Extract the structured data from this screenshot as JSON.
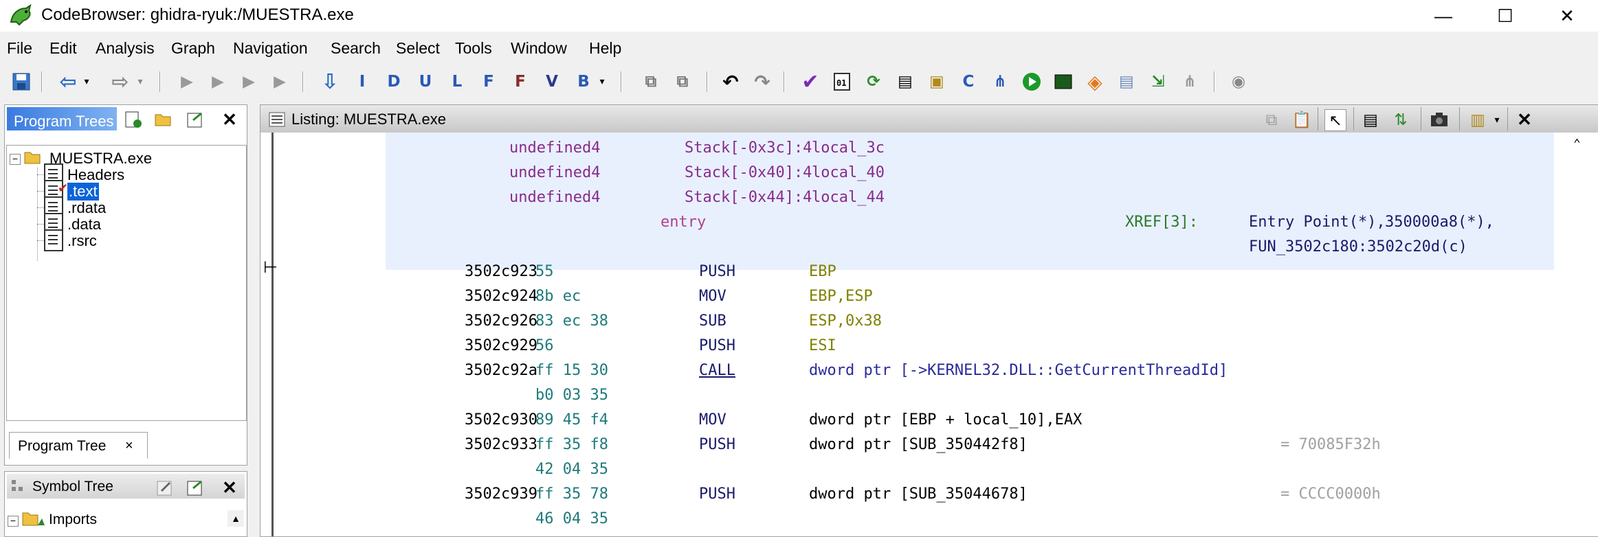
{
  "window": {
    "title": "CodeBrowser: ghidra-ryuk:/MUESTRA.exe",
    "minimize": "—",
    "maximize": "☐",
    "close": "✕"
  },
  "menu": [
    "File",
    "Edit",
    "Analysis",
    "Graph",
    "Navigation",
    "Search",
    "Select",
    "Tools",
    "Window",
    "Help"
  ],
  "toolbar": {
    "letters": [
      "I",
      "D",
      "U",
      "L",
      "F",
      "V",
      "B"
    ]
  },
  "program_trees": {
    "title": "Program Trees",
    "root": "MUESTRA.exe",
    "items": [
      "Headers",
      ".text",
      ".rdata",
      ".data",
      ".rsrc"
    ],
    "selected": ".text",
    "tab_label": "Program Tree",
    "tab_close": "×",
    "close": "✕"
  },
  "symbol_tree": {
    "title": "Symbol Tree",
    "first_item": "Imports",
    "close": "✕"
  },
  "listing": {
    "title": "Listing:  MUESTRA.exe",
    "close": "✕",
    "locals": [
      {
        "type": "undefined4",
        "storage": "Stack[-0x3c]:4",
        "name": "local_3c"
      },
      {
        "type": "undefined4",
        "storage": "Stack[-0x40]:4",
        "name": "local_40"
      },
      {
        "type": "undefined4",
        "storage": "Stack[-0x44]:4",
        "name": "local_44"
      }
    ],
    "label": "entry",
    "xref_label": "XREF[3]:",
    "xref_1_a": "Entry Point(*),",
    "xref_1_b": "350000a8(*),",
    "xref_2": "FUN_3502c180:3502c20d(c)",
    "rows": [
      {
        "addr": "3502c923",
        "bytes": "55",
        "mnem": "PUSH",
        "ops": "EBP",
        "bytes2": "",
        "comment": ""
      },
      {
        "addr": "3502c924",
        "bytes": "8b ec",
        "mnem": "MOV",
        "ops": "EBP,ESP",
        "bytes2": "",
        "comment": ""
      },
      {
        "addr": "3502c926",
        "bytes": "83 ec 38",
        "mnem": "SUB",
        "ops": "ESP,0x38",
        "bytes2": "",
        "comment": ""
      },
      {
        "addr": "3502c929",
        "bytes": "56",
        "mnem": "PUSH",
        "ops": "ESI",
        "bytes2": "",
        "comment": ""
      },
      {
        "addr": "3502c92a",
        "bytes": "ff 15 30",
        "mnem": "CALL",
        "ops": "dword ptr [->KERNEL32.DLL::GetCurrentThreadId]",
        "bytes2": "b0 03 35",
        "comment": ""
      },
      {
        "addr": "3502c930",
        "bytes": "89 45 f4",
        "mnem": "MOV",
        "ops": "dword ptr [EBP + local_10],EAX",
        "bytes2": "",
        "comment": ""
      },
      {
        "addr": "3502c933",
        "bytes": "ff 35 f8",
        "mnem": "PUSH",
        "ops": "dword ptr [SUB_350442f8]",
        "bytes2": "42 04 35",
        "comment": "= 70085F32h"
      },
      {
        "addr": "3502c939",
        "bytes": "ff 35 78",
        "mnem": "PUSH",
        "ops": "dword ptr [SUB_35044678]",
        "bytes2": "46 04 35",
        "comment": "= CCCC0000h"
      }
    ]
  }
}
